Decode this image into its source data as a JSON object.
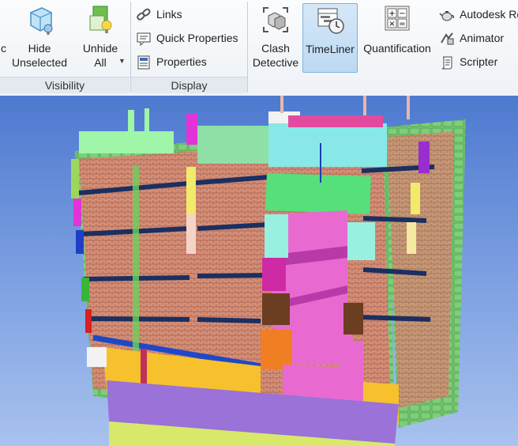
{
  "ribbon": {
    "visibility": {
      "panel_label": "Visibility",
      "partial_label": "c",
      "hide_unselected": "Hide\nUnselected",
      "unhide_all": "Unhide\nAll"
    },
    "display": {
      "panel_label": "Display",
      "links": "Links",
      "quick_properties": "Quick Properties",
      "properties": "Properties"
    },
    "tools": {
      "clash_detective": "Clash\nDetective",
      "timeliner": "TimeLiner",
      "quantification": "Quantification",
      "autodesk_rendering": "Autodesk Re",
      "animator": "Animator",
      "scripter": "Scripter"
    }
  },
  "colors": {
    "accent_active": "#bcd9f2",
    "sky_top": "#4d79cf",
    "sky_bottom": "#a9c2ee"
  },
  "viewport": {
    "description_icon": "building-3d-model"
  }
}
